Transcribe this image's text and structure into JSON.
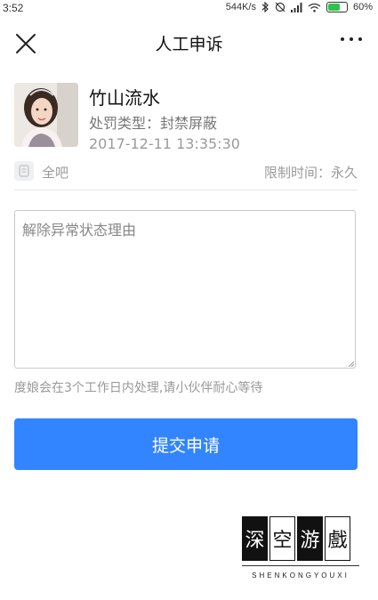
{
  "status_bar": {
    "time": "3:52",
    "network_speed": "544K/s",
    "battery_percent": "60%",
    "icons": [
      "bluetooth-icon",
      "alarm-off-icon",
      "signal-icon",
      "wifi-icon",
      "battery-icon"
    ]
  },
  "nav": {
    "title": "人工申诉",
    "close_icon": "close-icon",
    "more_icon": "more-icon"
  },
  "user": {
    "name": "竹山流水",
    "punish_type": "处罚类型：封禁屏蔽",
    "punish_time": "2017-12-11 13:35:30"
  },
  "scope": {
    "label": "全吧",
    "limit": "限制时间：永久"
  },
  "form": {
    "reason_placeholder": "解除异常状态理由",
    "hint": "度娘会在3个工作日内处理,请小伙伴耐心等待",
    "submit_label": "提交申请"
  },
  "watermark": {
    "chars": [
      "深",
      "空",
      "游",
      "戲"
    ],
    "subtitle": "SHENKONGYOUXI"
  },
  "colors": {
    "primary": "#3385ff",
    "battery_fill": "#2cc44a"
  }
}
